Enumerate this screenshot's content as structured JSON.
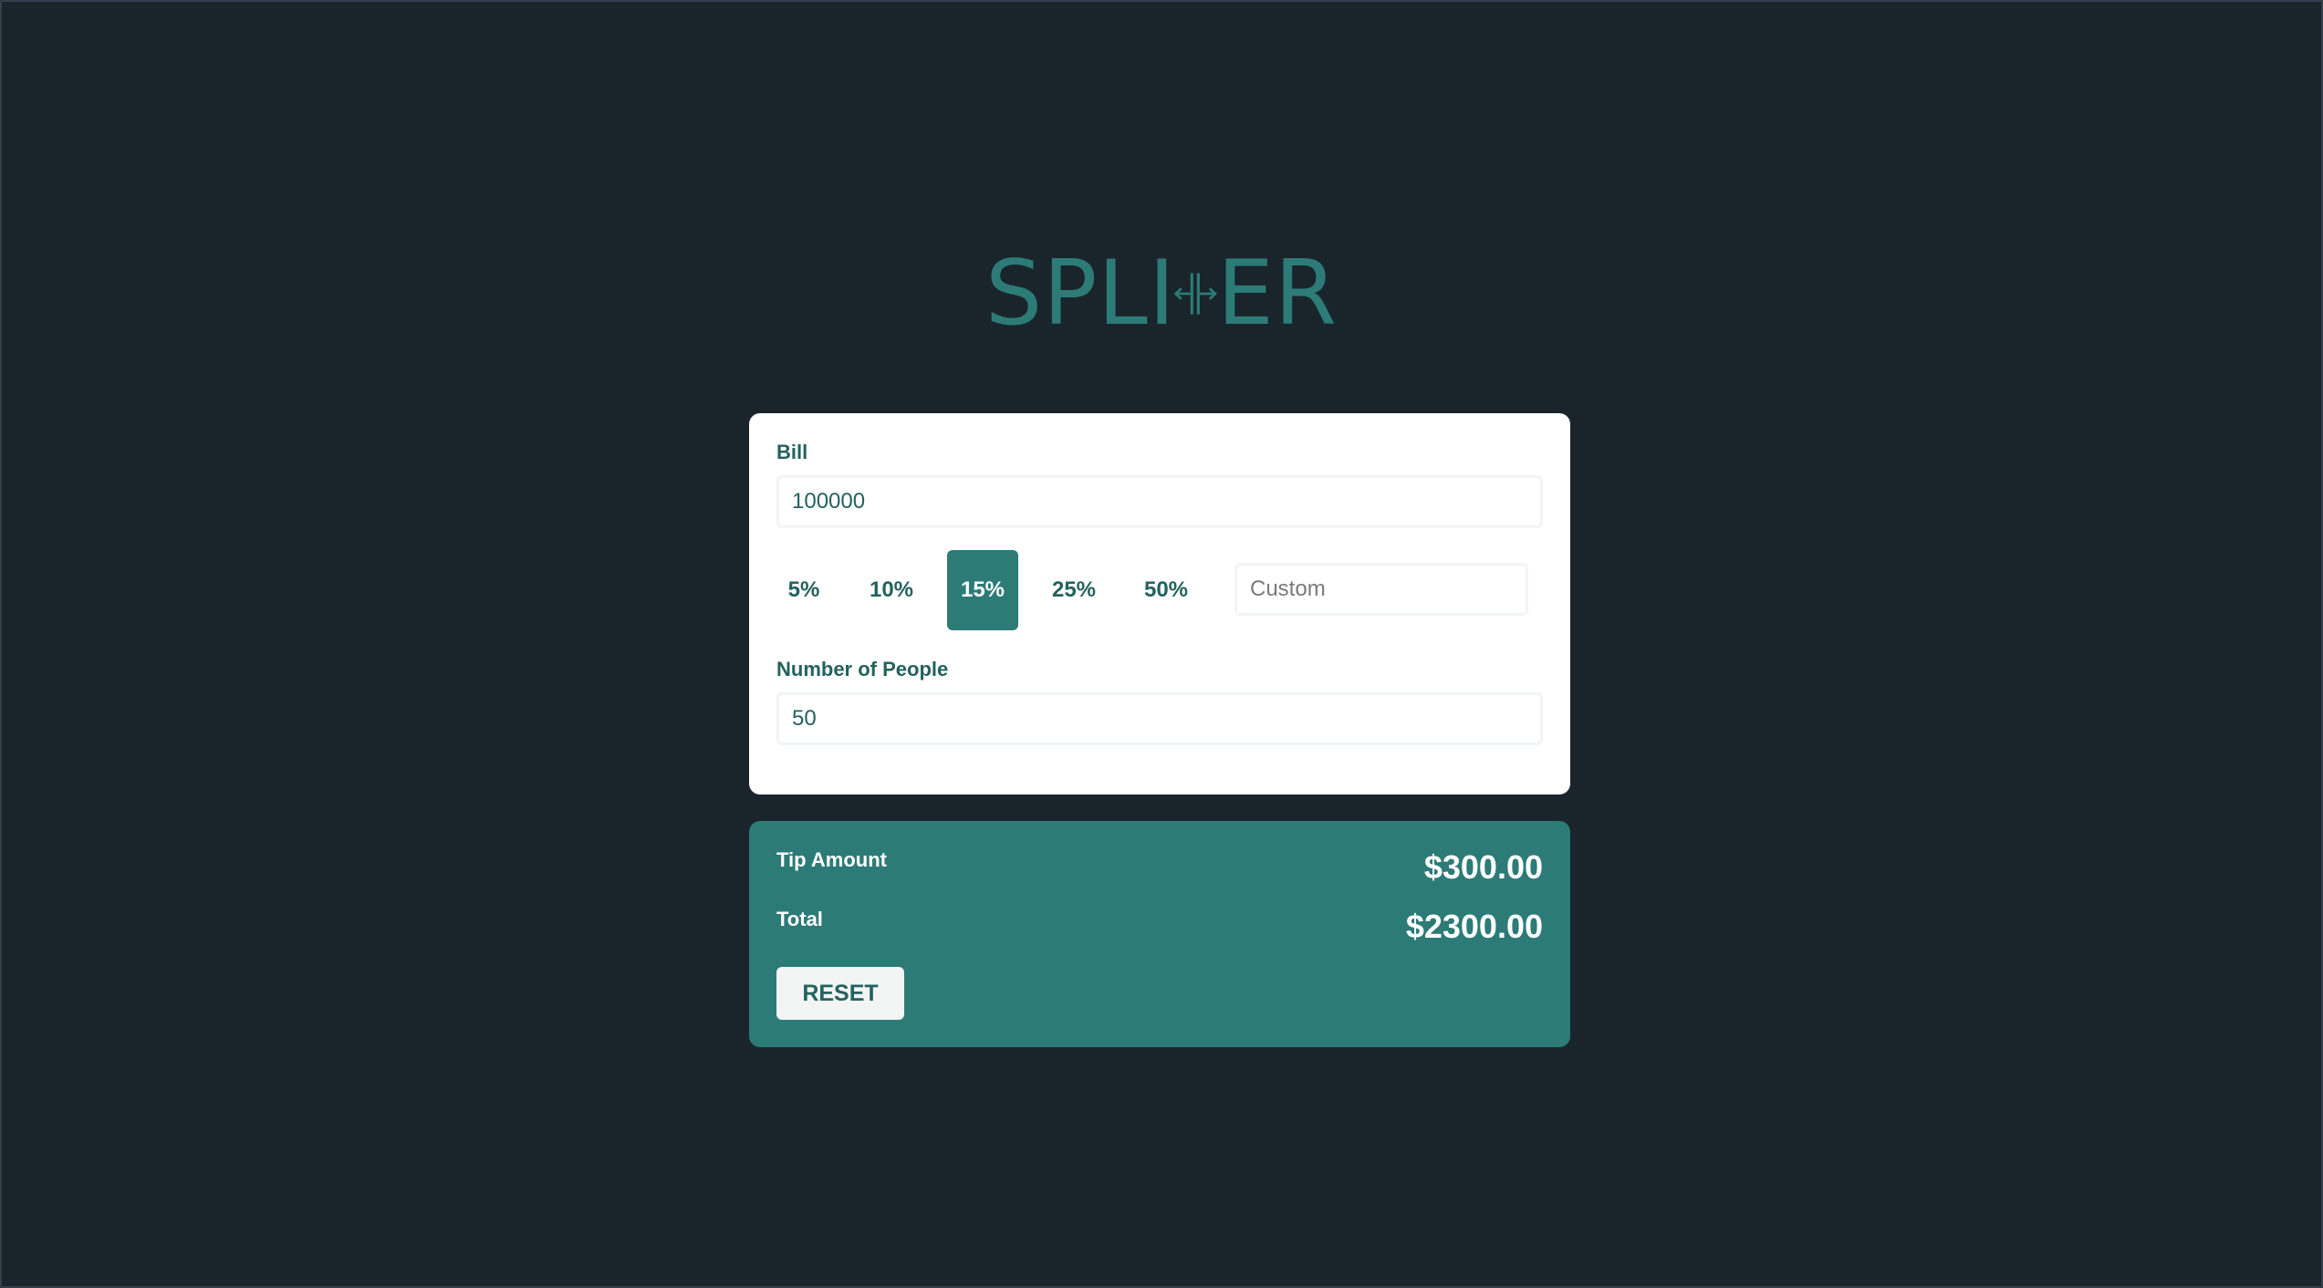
{
  "logo": {
    "text_left": "SPLI",
    "text_right": "ER",
    "color": "#2c7b77",
    "icon": "split-arrows-icon"
  },
  "bill": {
    "label": "Bill",
    "value": "100000"
  },
  "tips": {
    "options": [
      "5%",
      "10%",
      "15%",
      "25%",
      "50%"
    ],
    "selected": "15%",
    "custom_placeholder": "Custom"
  },
  "people": {
    "label": "Number of People",
    "value": "50"
  },
  "results": {
    "tip_label": "Tip Amount",
    "tip_value": "$300.00",
    "total_label": "Total",
    "total_value": "$2300.00",
    "reset_label": "RESET"
  },
  "colors": {
    "background": "#19252b",
    "accent": "#2c7b77",
    "text_dark": "#24625e",
    "card": "#ffffff"
  }
}
